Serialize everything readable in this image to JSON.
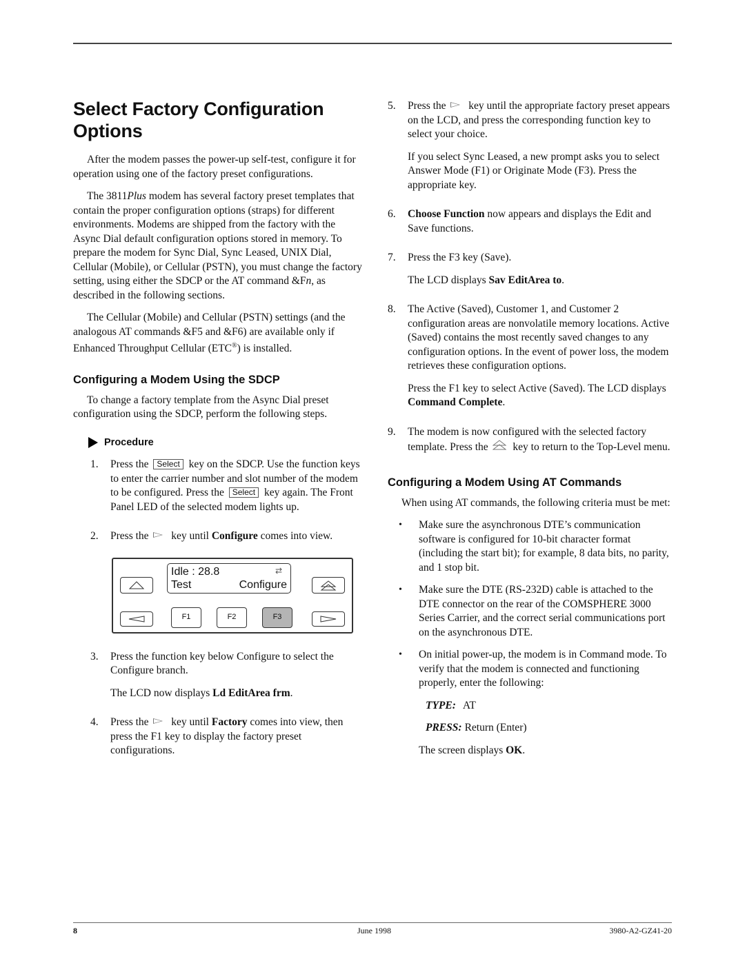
{
  "page": {
    "title": "Select Factory Configuration Options",
    "intro_paragraphs": [
      "After the modem passes the power-up self-test, configure it for operation using one of the factory preset configurations."
    ],
    "para2": {
      "pre": "The 3811",
      "italic": "Plus",
      "mid": " modem has several factory preset templates that contain the proper configuration options (straps) for different environments. Modems are shipped from the factory with the Async Dial default configuration options stored in memory. To prepare the modem for Sync Dial, Sync Leased, UNIX Dial, Cellular (Mobile), or Cellular (PSTN), you must change the factory setting, using either the SDCP or the AT command &F",
      "italic2": "n",
      "post": ", as described in the following sections."
    },
    "para3": {
      "pre": "The Cellular (Mobile) and Cellular (PSTN) settings (and the analogous AT commands &F5 and &F6) are available only if Enhanced Throughput Cellular (ETC",
      "sup": "®",
      "post": ") is installed."
    }
  },
  "sdcp_section": {
    "heading": "Configuring a Modem Using the SDCP",
    "intro": "To change a factory template from the Async Dial preset configuration using the SDCP, perform the following steps.",
    "procedure_label": "Procedure",
    "steps": [
      {
        "num": "1.",
        "a": "Press the",
        "key1": "Select",
        "b": "key on the SDCP. Use the function keys to enter the carrier number and slot number of the modem to be configured. Press the",
        "key2": "Select",
        "c": "key again. The Front Panel LED of the selected modem lights up."
      },
      {
        "num": "2.",
        "a": "Press the",
        "b": "key until ",
        "bold": "Configure",
        "c": " comes into view."
      },
      {
        "num": "3.",
        "a": "Press the function key below Configure to select the Configure branch.",
        "sub_pre": "The LCD now displays ",
        "sub_bold": "Ld EditArea frm",
        "sub_post": "."
      },
      {
        "num": "4.",
        "a": "Press the",
        "b": "key until ",
        "bold": "Factory",
        "c": " comes into view, then press the F1 key to display the factory preset configurations."
      }
    ],
    "panel": {
      "lcd_line1": "Idle : 28.8",
      "lcd_line2_left": "Test",
      "lcd_line2_right": "Configure",
      "lcd_symbol": "⇄",
      "f1": "F1",
      "f2": "F2",
      "f3": "F3",
      "active_key": "F3"
    }
  },
  "right_steps": [
    {
      "num": "5.",
      "a": "Press the",
      "b": "key until the appropriate factory preset appears on the LCD, and press the corresponding function key to select your choice.",
      "sub": "If you select Sync Leased, a new prompt asks you to select Answer Mode (F1) or Originate Mode (F3). Press the appropriate key."
    },
    {
      "num": "6.",
      "bold": "Choose Function",
      "a": " now appears and displays the Edit and Save functions."
    },
    {
      "num": "7.",
      "a": "Press the F3 key (Save).",
      "sub_pre": "The LCD displays ",
      "sub_bold": "Sav EditArea to",
      "sub_post": "."
    },
    {
      "num": "8.",
      "a": "The Active (Saved), Customer 1, and Customer 2 configuration areas are nonvolatile memory locations. Active (Saved) contains the most recently saved changes to any configuration options. In the event of power loss, the modem retrieves these configuration options.",
      "sub_pre": "Press the F1 key to select Active (Saved). The LCD displays ",
      "sub_bold": "Command Complete",
      "sub_post": "."
    },
    {
      "num": "9.",
      "a": "The modem is now configured with the selected factory template. Press the",
      "b": "key to return to the Top-Level menu."
    }
  ],
  "at_section": {
    "heading": "Configuring a Modem Using AT Commands",
    "intro": "When using AT commands, the following criteria must be met:",
    "bullets": [
      "Make sure the asynchronous DTE’s communication software is configured for 10-bit character format (including the start bit); for example, 8 data bits, no parity, and 1 stop bit.",
      "Make sure the DTE (RS-232D) cable is attached to the DTE connector on the rear of the COMSPHERE 3000 Series Carrier, and the correct serial communications port on the asynchronous DTE.",
      "On initial power-up, the modem is in Command mode. To verify that the modem is connected and functioning properly, enter the following:"
    ],
    "type_label": "TYPE:",
    "type_value": "AT",
    "press_label": "PRESS:",
    "press_value": "Return (Enter)",
    "result_pre": "The screen displays ",
    "result_bold": "OK",
    "result_post": "."
  },
  "footer": {
    "page_number": "8",
    "date": "June 1998",
    "doc_id": "3980-A2-GZ41-20"
  }
}
